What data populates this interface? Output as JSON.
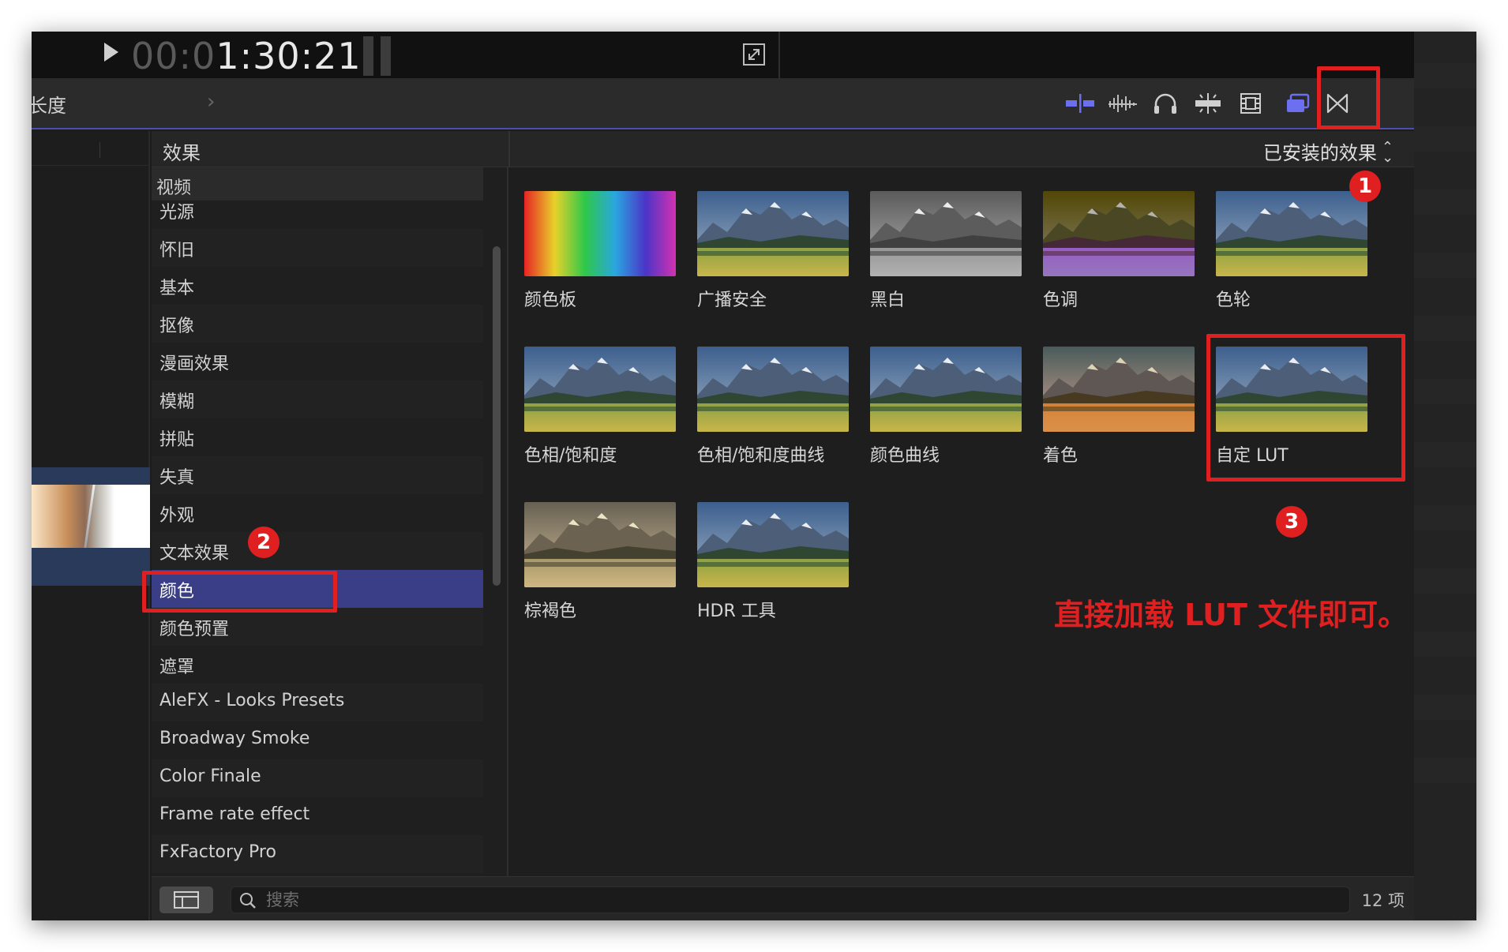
{
  "viewer": {
    "timecode_dim": "00:0",
    "timecode_bright": "1:30:21"
  },
  "toolbar": {
    "duration_label": "长度",
    "colors": {
      "accent": "#4a4fb0",
      "active_icon": "#6b6ff0"
    }
  },
  "effects": {
    "title": "效果",
    "installed_select": "已安装的效果",
    "categories_group": "视频",
    "categories": [
      "光源",
      "怀旧",
      "基本",
      "抠像",
      "漫画效果",
      "模糊",
      "拼贴",
      "失真",
      "外观",
      "文本效果",
      "颜色",
      "颜色预置",
      "遮罩",
      "AleFX - Looks Presets",
      "Broadway Smoke",
      "Color Finale",
      "Frame rate effect",
      "FxFactory Pro"
    ],
    "selected_category": "颜色",
    "tiles": [
      {
        "label": "颜色板",
        "style": "rainbow"
      },
      {
        "label": "广播安全",
        "style": "normal"
      },
      {
        "label": "黑白",
        "style": "bw"
      },
      {
        "label": "色调",
        "style": "tint"
      },
      {
        "label": "色轮",
        "style": "normal"
      },
      {
        "label": "色相/饱和度",
        "style": "normal"
      },
      {
        "label": "色相/饱和度曲线",
        "style": "normal"
      },
      {
        "label": "颜色曲线",
        "style": "normal"
      },
      {
        "label": "着色",
        "style": "colorize"
      },
      {
        "label": "自定 LUT",
        "style": "normal"
      },
      {
        "label": "棕褐色",
        "style": "sepia"
      },
      {
        "label": "HDR 工具",
        "style": "normal"
      }
    ]
  },
  "bottom": {
    "search_placeholder": "搜索",
    "item_count": "12 项"
  },
  "annotations": {
    "badge1": "1",
    "badge2": "2",
    "badge3": "3",
    "note": "直接加载 LUT 文件即可。",
    "color": "#e02020"
  }
}
